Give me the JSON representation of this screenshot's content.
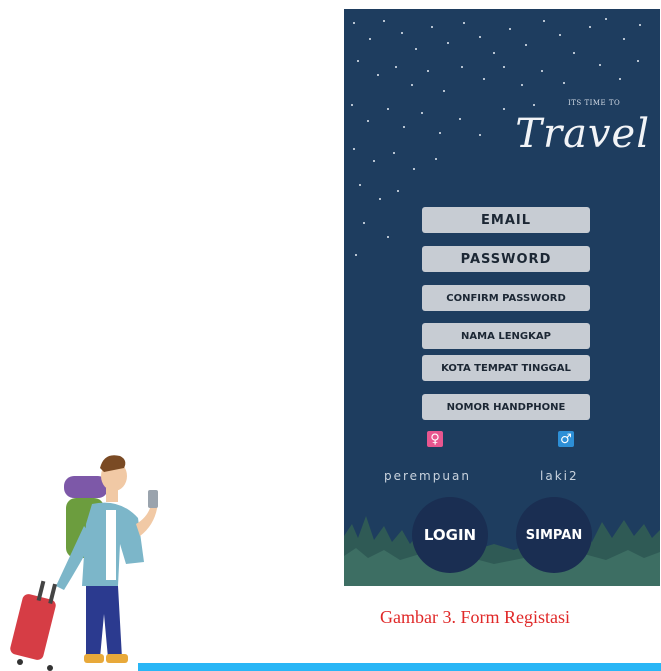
{
  "app": {
    "tagline": "ITS TIME TO",
    "brand": "Travel"
  },
  "form": {
    "email_label": "EMAIL",
    "password_label": "PASSWORD",
    "confirm_password_label": "CONFIRM PASSWORD",
    "full_name_label": "NAMA LENGKAP",
    "city_label": "KOTA TEMPAT TINGGAL",
    "phone_label": "NOMOR HANDPHONE"
  },
  "gender": {
    "female_symbol": "♀",
    "male_symbol": "♂",
    "female_label": "perempuan",
    "male_label": "laki2"
  },
  "buttons": {
    "login_label": "LOGIN",
    "save_label": "SIMPAN"
  },
  "figure": {
    "caption": "Gambar 3. Form Registasi"
  },
  "colors": {
    "background": "#1e3d5f",
    "field": "#c7ccd3",
    "button": "#1a2e52",
    "female": "#e8568f",
    "male": "#2d8fd6",
    "caption": "#e02828",
    "accent_bar": "#29b6f6"
  }
}
